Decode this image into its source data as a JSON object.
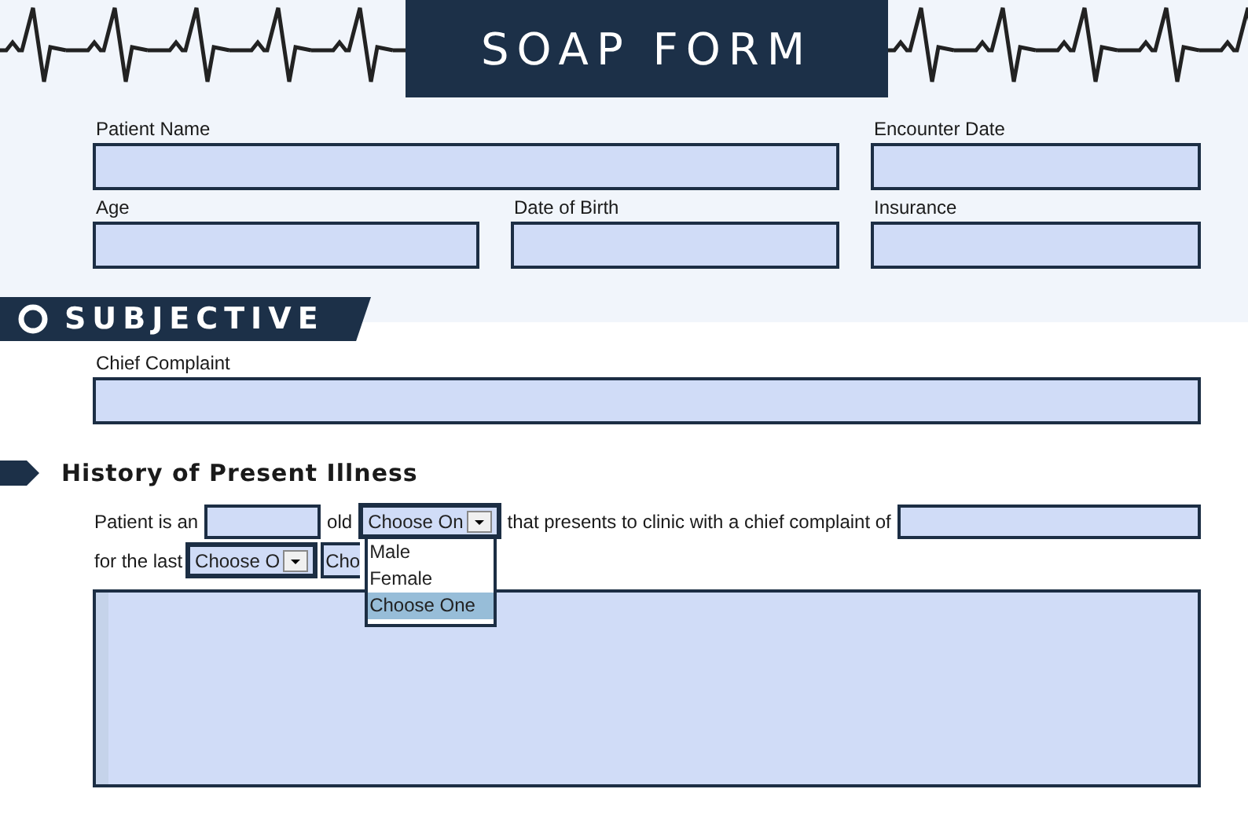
{
  "header": {
    "title": "SOAP FORM"
  },
  "demographics": [
    {
      "fields": [
        {
          "label": "Patient Name"
        },
        {
          "label": "Encounter Date"
        }
      ]
    },
    {
      "fields": [
        {
          "label": "Age"
        },
        {
          "label": "Date of Birth"
        },
        {
          "label": "Insurance"
        }
      ]
    }
  ],
  "section": {
    "title": "SUBJECTIVE",
    "chief_complaint": {
      "label": "Chief Complaint"
    },
    "hpi": {
      "title": "History of Present Illness",
      "lines": [
        [
          {
            "kind": "text",
            "text": "Patient is an"
          },
          {
            "kind": "input"
          },
          {
            "kind": "text",
            "text": "old"
          },
          {
            "kind": "select",
            "value": "Choose On",
            "expanded": true,
            "options": [
              {
                "label": "Male",
                "selected": false
              },
              {
                "label": "Female",
                "selected": false
              },
              {
                "label": "Choose One",
                "selected": true
              }
            ]
          },
          {
            "kind": "text",
            "text": "that presents to clinic with a chief complaint of"
          },
          {
            "kind": "input"
          }
        ],
        [
          {
            "kind": "text",
            "text": "for the last"
          },
          {
            "kind": "select",
            "value": "Choose O"
          },
          {
            "kind": "select",
            "value": "Cho"
          }
        ]
      ]
    }
  }
}
